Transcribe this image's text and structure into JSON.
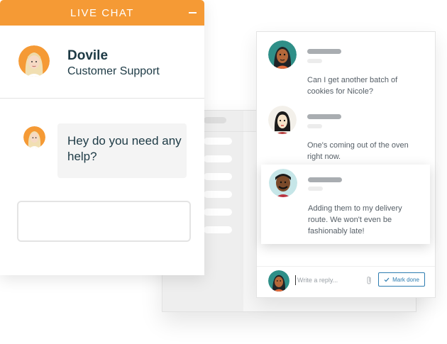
{
  "live_chat": {
    "header_title": "LIVE CHAT",
    "agent_name": "Dovile",
    "agent_role": "Customer Support",
    "message": "Hey do you need any help?"
  },
  "conversation": {
    "messages": [
      {
        "text": "Can I get another batch of cookies for Nicole?"
      },
      {
        "text": "One's coming out of the oven right now."
      },
      {
        "text": "Adding them to my delivery route. We won't even be fashionably late!"
      }
    ],
    "reply_placeholder": "Write a reply...",
    "mark_done_label": "Mark done"
  },
  "icons": {
    "minimize": "minimize-icon",
    "attach": "paperclip-icon",
    "check": "checkmark-icon"
  },
  "colors": {
    "header_orange": "#f59a35",
    "accent_blue": "#2c7cb0"
  }
}
